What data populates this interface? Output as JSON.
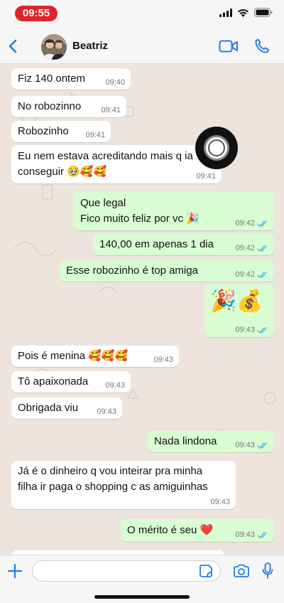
{
  "status_bar": {
    "time": "09:55",
    "accent_color": "#e0242a",
    "icons": [
      "signal-icon",
      "wifi-icon",
      "battery-icon"
    ]
  },
  "header": {
    "contact_name": "Beatriz",
    "icons": [
      "back-chevron-icon",
      "video-call-icon",
      "phone-call-icon"
    ],
    "accent_color": "#1d7ee8"
  },
  "messages": [
    {
      "dir": "in",
      "text": "Fiz 140 ontem",
      "time": "09:40"
    },
    {
      "dir": "in",
      "text": "No robozinno",
      "time": "09:41"
    },
    {
      "dir": "in",
      "text": "Robozinho",
      "time": "09:41"
    },
    {
      "dir": "in",
      "text": "Eu nem estava acreditando mais q ia\nconseguir 🥹🥰🥰",
      "time": "09:41"
    },
    {
      "dir": "out",
      "text": "Que legal\nFico muito feliz por vc 🎉",
      "time": "09:42"
    },
    {
      "dir": "out",
      "text": "140,00 em apenas 1 dia",
      "time": "09:42"
    },
    {
      "dir": "out",
      "text": "Esse robozinho é top amiga",
      "time": "09:42"
    },
    {
      "dir": "out",
      "text": "🎉💰",
      "time": "09:43"
    },
    {
      "dir": "in",
      "text": "Pois é menina 🥰🥰🥰",
      "time": "09:43"
    },
    {
      "dir": "in",
      "text": "Tô apaixonada",
      "time": "09:43"
    },
    {
      "dir": "in",
      "text": "Obrigada viu",
      "time": "09:43"
    },
    {
      "dir": "out",
      "text": "Nada lindona",
      "time": "09:43"
    },
    {
      "dir": "in",
      "text": "Já é o dinheiro q vou inteirar pra minha\nfilha ir paga o shopping c as amiguinhas",
      "time": "09:43"
    },
    {
      "dir": "out",
      "text": "O mérito é seu ❤️",
      "time": "09:43"
    }
  ],
  "colors": {
    "chat_background": "#ede5dd",
    "incoming_bubble": "#ffffff",
    "outgoing_bubble": "#d8fdd2",
    "read_ticks": "#53bdeb"
  },
  "input_bar": {
    "value": "",
    "placeholder": "",
    "icons": [
      "plus-icon",
      "sticker-icon",
      "camera-icon",
      "microphone-icon"
    ]
  }
}
